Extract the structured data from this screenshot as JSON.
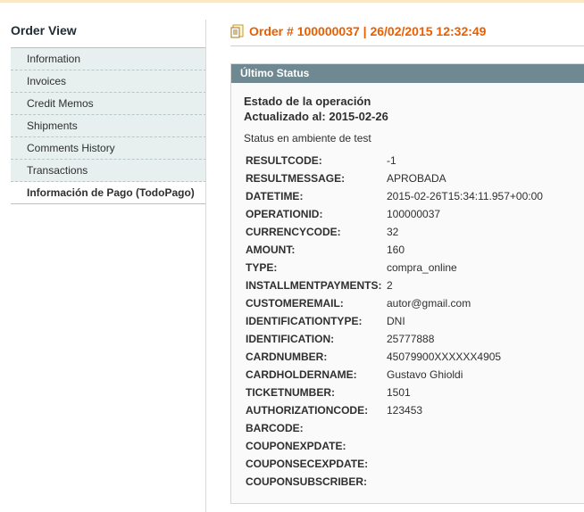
{
  "sidebar": {
    "title": "Order View",
    "items": [
      {
        "label": "Information"
      },
      {
        "label": "Invoices"
      },
      {
        "label": "Credit Memos"
      },
      {
        "label": "Shipments"
      },
      {
        "label": "Comments History"
      },
      {
        "label": "Transactions"
      },
      {
        "label": "Información de Pago (TodoPago)"
      }
    ]
  },
  "header": {
    "icon": "order-document-icon",
    "title": "Order # 100000037 | 26/02/2015 12:32:49",
    "title_color": "#eb5e00"
  },
  "status_box": {
    "heading": "Último Status",
    "operation_title": "Estado de la operación",
    "updated": "Actualizado al: 2015-02-26",
    "note": "Status en ambiente de test",
    "fields": [
      {
        "label": "RESULTCODE:",
        "value": "-1"
      },
      {
        "label": "RESULTMESSAGE:",
        "value": "APROBADA"
      },
      {
        "label": "DATETIME:",
        "value": "2015-02-26T15:34:11.957+00:00"
      },
      {
        "label": "OPERATIONID:",
        "value": "100000037"
      },
      {
        "label": "CURRENCYCODE:",
        "value": "32"
      },
      {
        "label": "AMOUNT:",
        "value": "160"
      },
      {
        "label": "TYPE:",
        "value": "compra_online"
      },
      {
        "label": "INSTALLMENTPAYMENTS:",
        "value": "2"
      },
      {
        "label": "CUSTOMEREMAIL:",
        "value": "autor@gmail.com"
      },
      {
        "label": "IDENTIFICATIONTYPE:",
        "value": "DNI"
      },
      {
        "label": "IDENTIFICATION:",
        "value": "25777888"
      },
      {
        "label": "CARDNUMBER:",
        "value": "45079900XXXXXX4905"
      },
      {
        "label": "CARDHOLDERNAME:",
        "value": "Gustavo Ghioldi"
      },
      {
        "label": "TICKETNUMBER:",
        "value": "1501"
      },
      {
        "label": "AUTHORIZATIONCODE:",
        "value": "123453"
      },
      {
        "label": "BARCODE:",
        "value": ""
      },
      {
        "label": "COUPONEXPDATE:",
        "value": ""
      },
      {
        "label": "COUPONSECEXPDATE:",
        "value": ""
      },
      {
        "label": "COUPONSUBSCRIBER:",
        "value": ""
      }
    ]
  }
}
